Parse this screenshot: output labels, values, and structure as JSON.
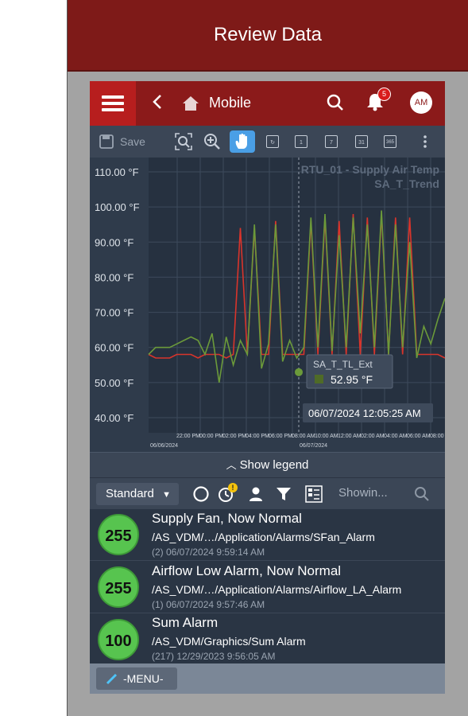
{
  "header": {
    "title": "Review Data"
  },
  "appbar": {
    "breadcrumb": "Mobile",
    "notification_count": "5",
    "avatar_initials": "AM"
  },
  "toolbar": {
    "save_label": "Save",
    "calendar_1": "1",
    "calendar_7": "7",
    "calendar_31": "31",
    "calendar_365": "365"
  },
  "chart_data": {
    "type": "line",
    "title": "RTU_01 - Supply Air Temp",
    "subtitle": "SA_T_Trend",
    "y_ticks": [
      "110.00 °F",
      "100.00 °F",
      "90.00 °F",
      "80.00 °F",
      "70.00 °F",
      "60.00 °F",
      "50.00 °F",
      "40.00 °F"
    ],
    "ylim": [
      35,
      115
    ],
    "x_ticks": [
      "22:00 PM",
      "00:00 PM",
      "02:00 PM",
      "04:00 PM",
      "06:00 PM",
      "08:00 AM",
      "10:00 AM",
      "12:00 AM",
      "02:00 AM",
      "04:00 AM",
      "06:00 AM",
      "08:00 AM"
    ],
    "x_dates": [
      "06/06/2024",
      "06/07/2024"
    ],
    "grid": true,
    "series": [
      {
        "color": "#d9342b",
        "values": [
          58,
          57,
          57,
          57,
          58,
          58,
          58,
          57,
          58,
          58,
          58,
          57,
          58,
          94,
          58,
          94,
          58,
          58,
          96,
          58,
          58,
          58,
          58,
          96,
          58,
          97,
          58,
          96,
          58,
          98,
          58,
          97,
          58,
          98,
          58,
          97,
          58,
          97,
          58,
          58,
          58,
          58,
          57
        ]
      },
      {
        "color": "#6b9a3a",
        "values": [
          58,
          60,
          60,
          60,
          61,
          62,
          63,
          62,
          58,
          64,
          50,
          63,
          55,
          62,
          58,
          95,
          54,
          61,
          95,
          56,
          62,
          57,
          60,
          97,
          60,
          98,
          59,
          92,
          60,
          97,
          64,
          95,
          60,
          99,
          58,
          95,
          60,
          90,
          57,
          66,
          61,
          68,
          74
        ]
      }
    ],
    "tooltip": {
      "series_name": "SA_T_TL_Ext",
      "value": "52.95 °F",
      "time": "06/07/2024 12:05:25 AM"
    }
  },
  "legend": {
    "label": "Show legend"
  },
  "filter": {
    "view": "Standard",
    "warning_badge": "!",
    "search_placeholder": "Showin..."
  },
  "alarms": [
    {
      "priority": "255",
      "title": "Supply Fan, Now Normal",
      "path": "/AS_VDM/…/Application/Alarms/SFan_Alarm",
      "time": "(2) 06/07/2024 9:59:14 AM"
    },
    {
      "priority": "255",
      "title": "Airflow Low Alarm, Now Normal",
      "path": "/AS_VDM/…/Application/Alarms/Airflow_LA_Alarm",
      "time": "(1) 06/07/2024 9:57:46 AM"
    },
    {
      "priority": "100",
      "title": "Sum Alarm",
      "path": "/AS_VDM/Graphics/Sum Alarm",
      "time": "(217) 12/29/2023 9:56:05 AM"
    }
  ],
  "bottom": {
    "menu_label": "-MENU-"
  }
}
